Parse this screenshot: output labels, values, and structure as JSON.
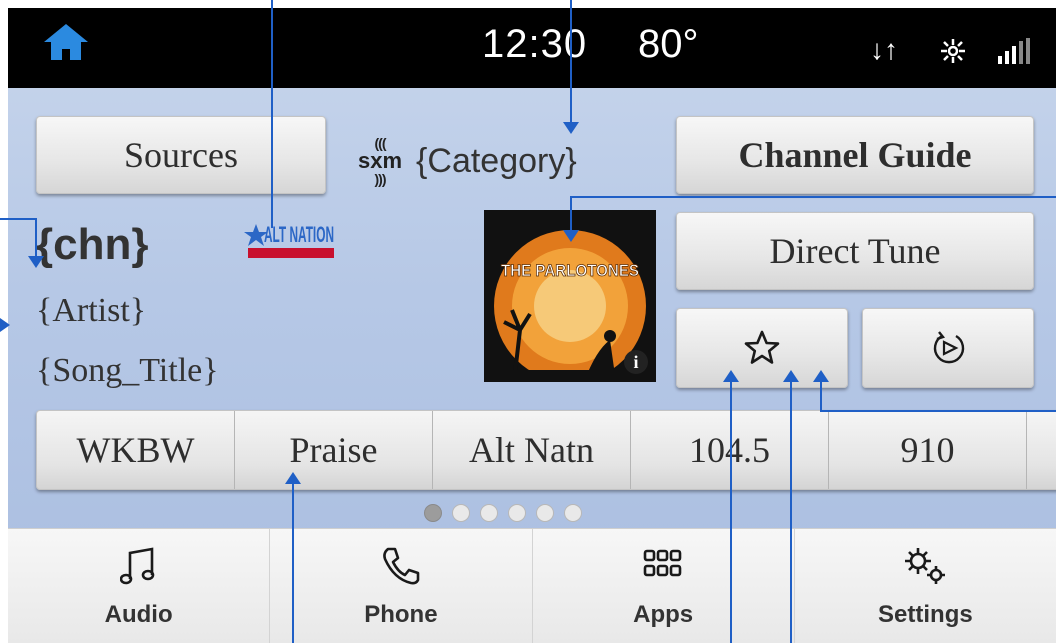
{
  "status": {
    "time": "12:30",
    "temperature": "80°"
  },
  "header": {
    "sources_label": "Sources",
    "brand": "sxm",
    "category": "{Category}",
    "channel_guide_label": "Channel Guide",
    "direct_tune_label": "Direct Tune"
  },
  "now_playing": {
    "channel": "{chn}",
    "artist": "{Artist}",
    "song_title": "{Song_Title}",
    "channel_logo_text": "ALT NATION",
    "album_text": "THE PARLOTONES",
    "album_info": "i"
  },
  "presets": [
    "WKBW",
    "Praise",
    "Alt Natn",
    "104.5",
    "910"
  ],
  "pagination": {
    "pages": 6,
    "active": 1
  },
  "nav": [
    {
      "label": "Audio",
      "icon": "music-note-icon"
    },
    {
      "label": "Phone",
      "icon": "phone-icon"
    },
    {
      "label": "Apps",
      "icon": "apps-grid-icon"
    },
    {
      "label": "Settings",
      "icon": "gears-icon"
    }
  ],
  "colors": {
    "background": "#b6c8e6",
    "statusbar": "#000000",
    "home": "#2b8ae0",
    "annotation": "#1f5fc6"
  }
}
